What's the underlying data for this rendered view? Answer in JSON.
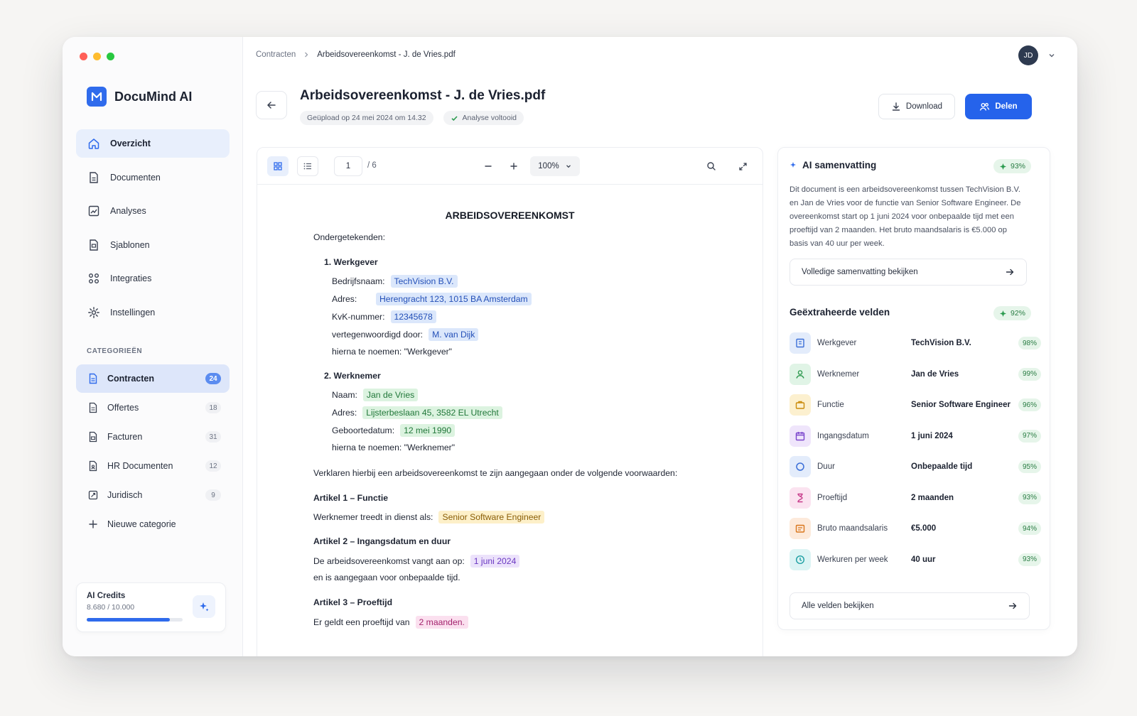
{
  "app": {
    "name": "DocuMind AI"
  },
  "colors": {
    "accent": "#2563eb",
    "success": "#2a7d44",
    "mac_red": "#ff5f57",
    "mac_yellow": "#febc2e",
    "mac_green": "#28c840"
  },
  "sidebar": {
    "nav": [
      {
        "label": "Overzicht",
        "icon": "home-icon",
        "active": true
      },
      {
        "label": "Documenten",
        "icon": "document-icon"
      },
      {
        "label": "Analyses",
        "icon": "chart-icon"
      },
      {
        "label": "Sjablonen",
        "icon": "template-icon"
      },
      {
        "label": "Integraties",
        "icon": "integrations-icon"
      },
      {
        "label": "Instellingen",
        "icon": "gear-icon"
      }
    ],
    "categories_title": "CATEGORIEËN",
    "categories": [
      {
        "label": "Contracten",
        "count": "24",
        "active": true
      },
      {
        "label": "Offertes",
        "count": "18"
      },
      {
        "label": "Facturen",
        "count": "31"
      },
      {
        "label": "HR Documenten",
        "count": "12"
      },
      {
        "label": "Juridisch",
        "count": "9"
      }
    ],
    "new_category": "Nieuwe categorie",
    "credits": {
      "title": "AI Credits",
      "value": "8.680 / 10.000",
      "fraction": 0.868
    }
  },
  "header": {
    "breadcrumb": [
      "Contracten",
      "Arbeidsovereenkomst - J. de Vries.pdf"
    ],
    "avatar": "JD",
    "title": "Arbeidsovereenkomst - J. de Vries.pdf",
    "uploaded": "Geüpload op 24 mei 2024 om 14.32",
    "status": "Analyse voltooid",
    "download": "Download",
    "share": "Delen"
  },
  "viewer": {
    "page": "1",
    "page_total": "/ 6",
    "zoom": "100%"
  },
  "document": {
    "heading": "ARBEIDSOVEREENKOMST",
    "signatories": "Ondergetekenden:",
    "employer_heading": "1. Werkgever",
    "employer": [
      {
        "label": "Bedrijfsnaam:",
        "value": "TechVision B.V."
      },
      {
        "label": "Adres:",
        "value": "Herengracht 123, 1015 BA Amsterdam"
      },
      {
        "label": "KvK-nummer:",
        "value": "12345678"
      },
      {
        "label": "vertegenwoordigd door:",
        "value": "M. van Dijk"
      }
    ],
    "employer_alias": "hierna te noemen: \"Werkgever\"",
    "employee_heading": "2. Werknemer",
    "employee": [
      {
        "label": "Naam:",
        "value": "Jan de Vries"
      },
      {
        "label": "Adres:",
        "value": "Lijsterbeslaan 45, 3582 EL Utrecht"
      },
      {
        "label": "Geboortedatum:",
        "value": "12 mei 1990"
      }
    ],
    "employee_alias": "hierna te noemen: \"Werknemer\"",
    "declaration": "Verklaren hierbij een arbeidsovereenkomst te zijn aangegaan onder de volgende voorwaarden:",
    "art1_title": "Artikel 1 – Functie",
    "art1_text": "Werknemer treedt in dienst als:",
    "art1_value": "Senior Software Engineer",
    "art2_title": "Artikel 2 – Ingangsdatum en duur",
    "art2_text": "De arbeidsovereenkomst vangt aan op:",
    "art2_value": "1 juni 2024",
    "art2_text2": "en is aangegaan voor onbepaalde tijd.",
    "art3_title": "Artikel 3 – Proeftijd",
    "art3_text": "Er geldt een proeftijd van",
    "art3_value": "2 maanden."
  },
  "summary": {
    "title": "AI samenvatting",
    "score": "93%",
    "text": "Dit document is een arbeidsovereenkomst tussen TechVision B.V. en Jan de Vries voor de functie van Senior Software Engineer. De overeenkomst start op 1 juni 2024 voor onbepaalde tijd met een proeftijd van 2 maanden. Het bruto maandsalaris is €5.000 op basis van 40 uur per week.",
    "link": "Volledige samenvatting bekijken"
  },
  "fields": {
    "title": "Geëxtraheerde velden",
    "score": "92%",
    "items": [
      {
        "label": "Werkgever",
        "value": "TechVision B.V.",
        "pct": "98%",
        "icon": "building-icon",
        "color": "#3b6fd8",
        "bg": "#e3ecfb"
      },
      {
        "label": "Werknemer",
        "value": "Jan de Vries",
        "pct": "99%",
        "icon": "user-icon",
        "color": "#2f9a50",
        "bg": "#e0f4e6"
      },
      {
        "label": "Functie",
        "value": "Senior Software Engineer",
        "pct": "96%",
        "icon": "briefcase-icon",
        "color": "#c98a0b",
        "bg": "#fcf0cf"
      },
      {
        "label": "Ingangsdatum",
        "value": "1 juni 2024",
        "pct": "97%",
        "icon": "calendar-icon",
        "color": "#7a45cc",
        "bg": "#efe5fb"
      },
      {
        "label": "Duur",
        "value": "Onbepaalde tijd",
        "pct": "95%",
        "icon": "infinity-icon",
        "color": "#3b6fd8",
        "bg": "#e3ecfb"
      },
      {
        "label": "Proeftijd",
        "value": "2 maanden",
        "pct": "93%",
        "icon": "hourglass-icon",
        "color": "#c63a8a",
        "bg": "#fbe3f0"
      },
      {
        "label": "Bruto maandsalaris",
        "value": "€5.000",
        "pct": "94%",
        "icon": "wallet-icon",
        "color": "#d9761c",
        "bg": "#fdeadb"
      },
      {
        "label": "Werkuren per week",
        "value": "40 uur",
        "pct": "93%",
        "icon": "clock-icon",
        "color": "#1e9fa3",
        "bg": "#dcf4f4"
      }
    ],
    "link": "Alle velden bekijken"
  }
}
